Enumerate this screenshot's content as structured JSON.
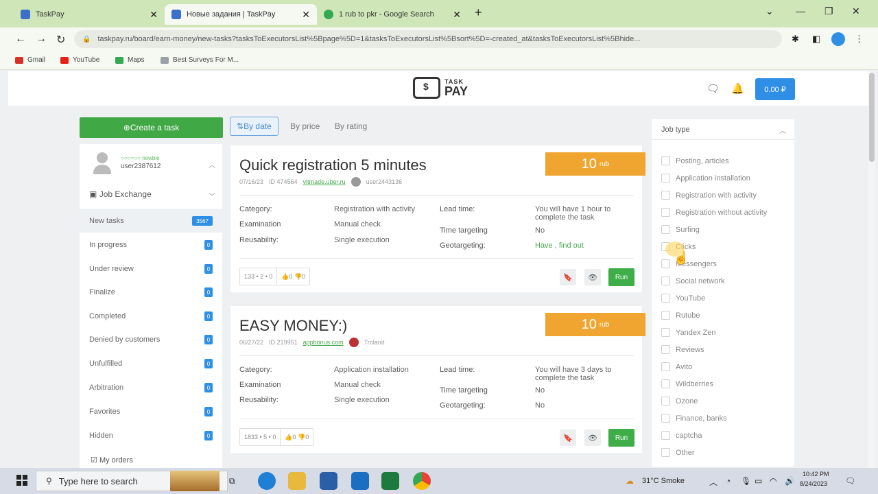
{
  "browser": {
    "tabs": [
      {
        "title": "TaskPay",
        "color": "#3b6fc9"
      },
      {
        "title": "Новые задания | TaskPay",
        "color": "#3b6fc9"
      },
      {
        "title": "1 rub to pkr - Google Search",
        "color": "#34a853"
      }
    ],
    "tab_close": "✕",
    "new_tab": "+",
    "url": "taskpay.ru/board/earn-money/new-tasks?tasksToExecutorsList%5Bpage%5D=1&tasksToExecutorsList%5Bsort%5D=-created_at&tasksToExecutorsList%5Bhide...",
    "bookmarks": [
      {
        "label": "Gmail",
        "color": "#d93025"
      },
      {
        "label": "YouTube",
        "color": "#e62117"
      },
      {
        "label": "Maps",
        "color": "#34a853"
      },
      {
        "label": "Best Surveys For M...",
        "color": "#9aa0a6"
      }
    ]
  },
  "header": {
    "logo_top": "TASK",
    "logo_bottom": "PAY",
    "logo_symbol": "$",
    "balance": "0.00 ₽"
  },
  "sidebar": {
    "create_label": "Create a task",
    "user_status": "○○○○○○ newbie",
    "username": "user2387612",
    "job_exchange": "Job Exchange",
    "menu": [
      {
        "label": "New tasks",
        "count": "3567"
      },
      {
        "label": "In progress",
        "count": "0"
      },
      {
        "label": "Under review",
        "count": "0"
      },
      {
        "label": "Finalize",
        "count": "0"
      },
      {
        "label": "Completed",
        "count": "0"
      },
      {
        "label": "Denied by customers",
        "count": "0"
      },
      {
        "label": "Unfulfilled",
        "count": "0"
      },
      {
        "label": "Arbitration",
        "count": "0"
      },
      {
        "label": "Favorites",
        "count": "0"
      },
      {
        "label": "Hidden",
        "count": "0"
      }
    ],
    "my_orders": "My orders"
  },
  "sort": {
    "by_date": "By date",
    "by_price": "By price",
    "by_rating": "By rating"
  },
  "tasks": [
    {
      "title": "Quick registration 5 minutes",
      "date": "07/16/23",
      "id": "ID 474564",
      "link": "vitmade.uber.ru",
      "author": "user2443136",
      "price": "10",
      "currency": "rub",
      "labels": {
        "category": "Category:",
        "examination": "Examination",
        "reusability": "Reusability:",
        "lead_time": "Lead time:",
        "time_targeting": "Time targeting",
        "geotargeting": "Geotargeting:"
      },
      "category": "Registration with activity",
      "examination": "Manual check",
      "reusability": "Single execution",
      "lead_time": "You will have 1 hour to complete the task",
      "time_targeting": "No",
      "geotargeting_value": "Have ,",
      "geotargeting_link": "find out",
      "stats": "133 • 2 • 0",
      "likes": "👍0 👎0",
      "run": "Run"
    },
    {
      "title": "EASY MONEY:)",
      "date": "06/27/22",
      "id": "ID 219951",
      "link": "appbonus.com",
      "author": "Trolanit",
      "price": "10",
      "currency": "rub",
      "labels": {
        "category": "Category:",
        "examination": "Examination",
        "reusability": "Reusability:",
        "lead_time": "Lead time:",
        "time_targeting": "Time targeting",
        "geotargeting": "Geotargeting:"
      },
      "category": "Application installation",
      "examination": "Manual check",
      "reusability": "Single execution",
      "lead_time": "You will have 3 days to complete the task",
      "time_targeting": "No",
      "geotargeting_value": "No",
      "geotargeting_link": "",
      "stats": "1833 • 5 • 0",
      "likes": "👍0 👎0",
      "run": "Run"
    }
  ],
  "filter": {
    "title": "Job type",
    "items": [
      "Posting, articles",
      "Application installation",
      "Registration with activity",
      "Registration without activity",
      "Surfing",
      "Clicks",
      "Messengers",
      "Social network",
      "YouTube",
      "Rutube",
      "Yandex Zen",
      "Reviews",
      "Avito",
      "Wildberries",
      "Ozone",
      "Finance, banks",
      "captcha",
      "Other"
    ]
  },
  "taskbar": {
    "search_placeholder": "Type here to search",
    "weather": "31°C Smoke",
    "time": "10:42 PM",
    "date": "8/24/2023"
  },
  "icons": {
    "back": "arrow-left-icon",
    "forward": "arrow-right-icon",
    "reload": "reload-icon",
    "chat": "chat-icon",
    "bell": "bell-icon",
    "bookmark": "bookmark-icon",
    "eye": "eye-icon"
  }
}
